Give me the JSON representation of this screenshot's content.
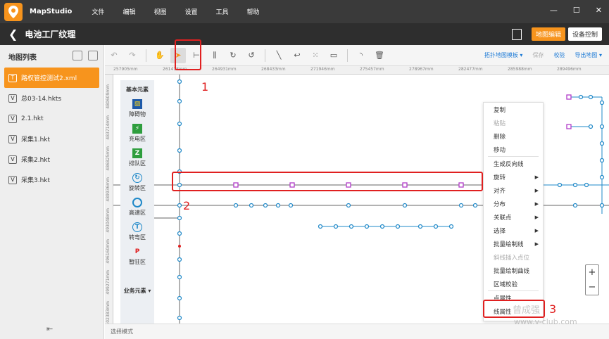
{
  "app": {
    "name": "MapStudio",
    "menu": [
      "文件",
      "编辑",
      "视图",
      "设置",
      "工具",
      "帮助"
    ]
  },
  "project": {
    "title": "电池工厂纹理",
    "btn_map_edit": "地图编辑",
    "btn_device_control": "设备控制"
  },
  "sidebar": {
    "title": "地图列表",
    "items": [
      {
        "badge": "T",
        "label": "路权管控测试2.xml",
        "active": true
      },
      {
        "badge": "V",
        "label": "总03-14.hkts"
      },
      {
        "badge": "V",
        "label": "2.1.hkt"
      },
      {
        "badge": "V",
        "label": "采集1.hkt"
      },
      {
        "badge": "V",
        "label": "采集2.hkt"
      },
      {
        "badge": "V",
        "label": "采集3.hkt"
      }
    ]
  },
  "toolbar": {
    "right": [
      "拓扑地图模板 ▾",
      "保存",
      "校验",
      "导出地图 ▾"
    ]
  },
  "ruler": {
    "top": [
      "257905mm",
      "261418mm",
      "264931mm",
      "268433mm",
      "271946mm",
      "275457mm",
      "278967mm",
      "282477mm",
      "285988mm",
      "289496mm"
    ],
    "left": [
      "480609mm",
      "483714mm",
      "486825mm",
      "489936mm",
      "493048mm",
      "496160mm",
      "499271mm",
      "502383mm"
    ]
  },
  "palette": {
    "title": "基本元素",
    "items": [
      "障碍物",
      "充电区",
      "排队区",
      "旋转区",
      "高速区",
      "转弯区",
      "暂驻区"
    ],
    "footer": "业务元素"
  },
  "context_menu": {
    "items": [
      {
        "label": "复制"
      },
      {
        "label": "粘贴",
        "disabled": true
      },
      {
        "label": "删除"
      },
      {
        "label": "移动"
      },
      {
        "sep": true
      },
      {
        "label": "生成反向线"
      },
      {
        "label": "旋转",
        "sub": true
      },
      {
        "label": "对齐",
        "sub": true
      },
      {
        "label": "分布",
        "sub": true
      },
      {
        "label": "关联点",
        "sub": true
      },
      {
        "label": "选择",
        "sub": true
      },
      {
        "label": "批量绘制线",
        "sub": true
      },
      {
        "label": "斜线插入点位",
        "disabled": true
      },
      {
        "label": "批量绘制曲线"
      },
      {
        "label": "区域校验"
      },
      {
        "sep": true
      },
      {
        "label": "点属性"
      },
      {
        "label": "线属性"
      }
    ]
  },
  "status": {
    "mode": "选择模式"
  },
  "annotations": [
    "1",
    "2",
    "3"
  ],
  "watermark": {
    "name": "曾成强",
    "url": "www.v-club.com"
  },
  "colors": {
    "accent": "#f7941d",
    "node": "#1e88c8",
    "selected_node": "#b03cc8",
    "annotation": "#e02020"
  }
}
